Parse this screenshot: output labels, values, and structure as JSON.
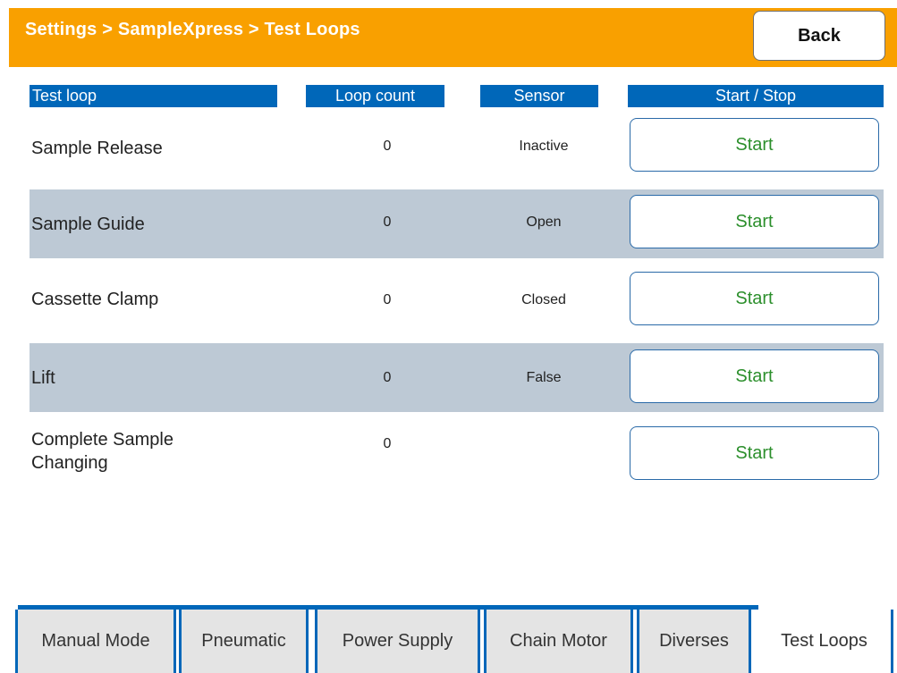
{
  "header": {
    "breadcrumb": "Settings > SampleXpress > Test Loops",
    "back_label": "Back"
  },
  "table": {
    "columns": [
      "Test loop",
      "Loop count",
      "Sensor",
      "Start / Stop"
    ],
    "rows": [
      {
        "name": "Sample Release",
        "count": "0",
        "sensor": "Inactive",
        "action": "Start"
      },
      {
        "name": "Sample Guide",
        "count": "0",
        "sensor": "Open",
        "action": "Start"
      },
      {
        "name": "Cassette Clamp",
        "count": "0",
        "sensor": "Closed",
        "action": "Start"
      },
      {
        "name": "Lift",
        "count": "0",
        "sensor": "False",
        "action": "Start"
      },
      {
        "name": "Complete Sample\nChanging",
        "count": "0",
        "sensor": "",
        "action": "Start"
      }
    ]
  },
  "tabs": [
    {
      "label": "Manual Mode",
      "active": false
    },
    {
      "label": "Pneumatic",
      "active": false
    },
    {
      "label": "Power Supply",
      "active": false
    },
    {
      "label": "Chain Motor",
      "active": false
    },
    {
      "label": "Diverses",
      "active": false
    },
    {
      "label": "Test Loops",
      "active": true
    }
  ],
  "colors": {
    "topbar": "#f9a000",
    "header_blue": "#0067b9",
    "row_shade": "#bdc9d5",
    "start_text": "#2c8f2c"
  }
}
